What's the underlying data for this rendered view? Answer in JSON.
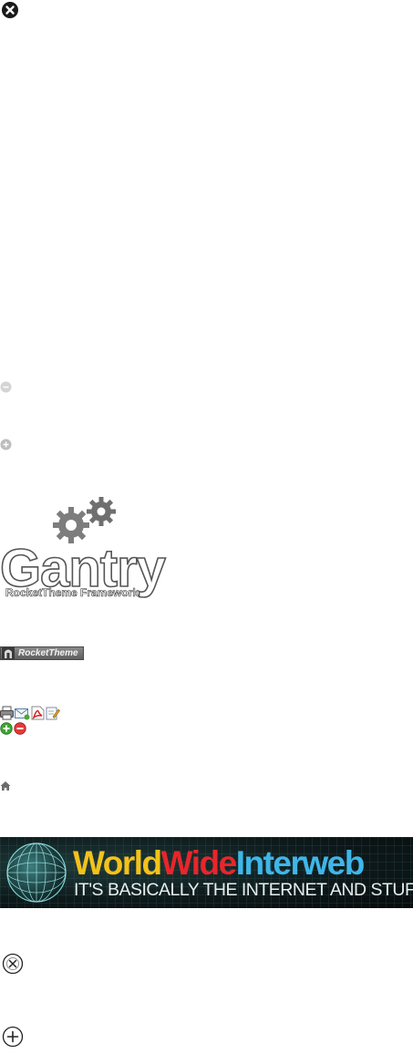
{
  "gantry": {
    "word": "Gantry",
    "subtitle": "RocketTheme Framework"
  },
  "rocket_badge": {
    "label": "RocketTheme"
  },
  "banner": {
    "title_part1": "World",
    "title_part2": "Wide",
    "title_part3": "Interweb",
    "tagline": "IT'S BASICALLY THE INTERNET AND STUFF"
  },
  "icons": {
    "close_top": "close-icon",
    "minus_grey": "minus-icon",
    "plus_grey": "plus-icon",
    "print": "printer-icon",
    "email": "email-icon",
    "pdf": "pdf-icon",
    "edit": "edit-icon",
    "add_green": "add-icon",
    "remove_red": "remove-icon",
    "home": "home-icon",
    "close_outline": "close-outline-icon",
    "plus_outline": "plus-outline-icon"
  },
  "colors": {
    "banner_yellow": "#f3c21a",
    "banner_red": "#e8262b",
    "banner_blue": "#3fb6e8"
  }
}
